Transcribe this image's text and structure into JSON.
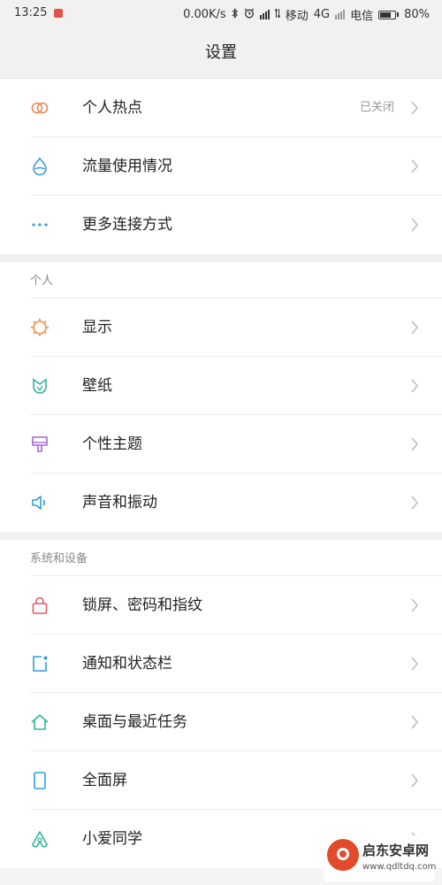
{
  "status_bar": {
    "time": "13:25",
    "speed": "0.00K/s",
    "carrier1": "移动",
    "network": "4G",
    "carrier2": "电信",
    "battery": "80%",
    "battery_level": 0.8
  },
  "header": {
    "title": "设置"
  },
  "section1": {
    "items": [
      {
        "label": "个人热点",
        "value": "已关闭",
        "icon": "hotspot-icon",
        "color": "#e8875a"
      },
      {
        "label": "流量使用情况",
        "value": "",
        "icon": "data-usage-icon",
        "color": "#3a9fd8"
      },
      {
        "label": "更多连接方式",
        "value": "",
        "icon": "more-connections-icon",
        "color": "#2f9fd8"
      }
    ]
  },
  "section2": {
    "label": "个人",
    "items": [
      {
        "label": "显示",
        "icon": "display-icon",
        "color": "#f08a3c"
      },
      {
        "label": "壁纸",
        "icon": "wallpaper-icon",
        "color": "#2fb59b"
      },
      {
        "label": "个性主题",
        "icon": "theme-icon",
        "color": "#a26ad8"
      },
      {
        "label": "声音和振动",
        "icon": "sound-icon",
        "color": "#2f9fd8"
      }
    ]
  },
  "section3": {
    "label": "系统和设备",
    "items": [
      {
        "label": "锁屏、密码和指纹",
        "icon": "lock-icon",
        "color": "#e25a67"
      },
      {
        "label": "通知和状态栏",
        "icon": "notification-icon",
        "color": "#2f9fd8"
      },
      {
        "label": "桌面与最近任务",
        "icon": "home-icon",
        "color": "#2fb59b"
      },
      {
        "label": "全面屏",
        "icon": "fullscreen-icon",
        "color": "#2f9fd8"
      },
      {
        "label": "小爱同学",
        "icon": "xiaoai-icon",
        "color": "#2fb59b"
      }
    ]
  },
  "watermark": {
    "name": "启东安卓网",
    "url": "www.qdltdq.com"
  }
}
